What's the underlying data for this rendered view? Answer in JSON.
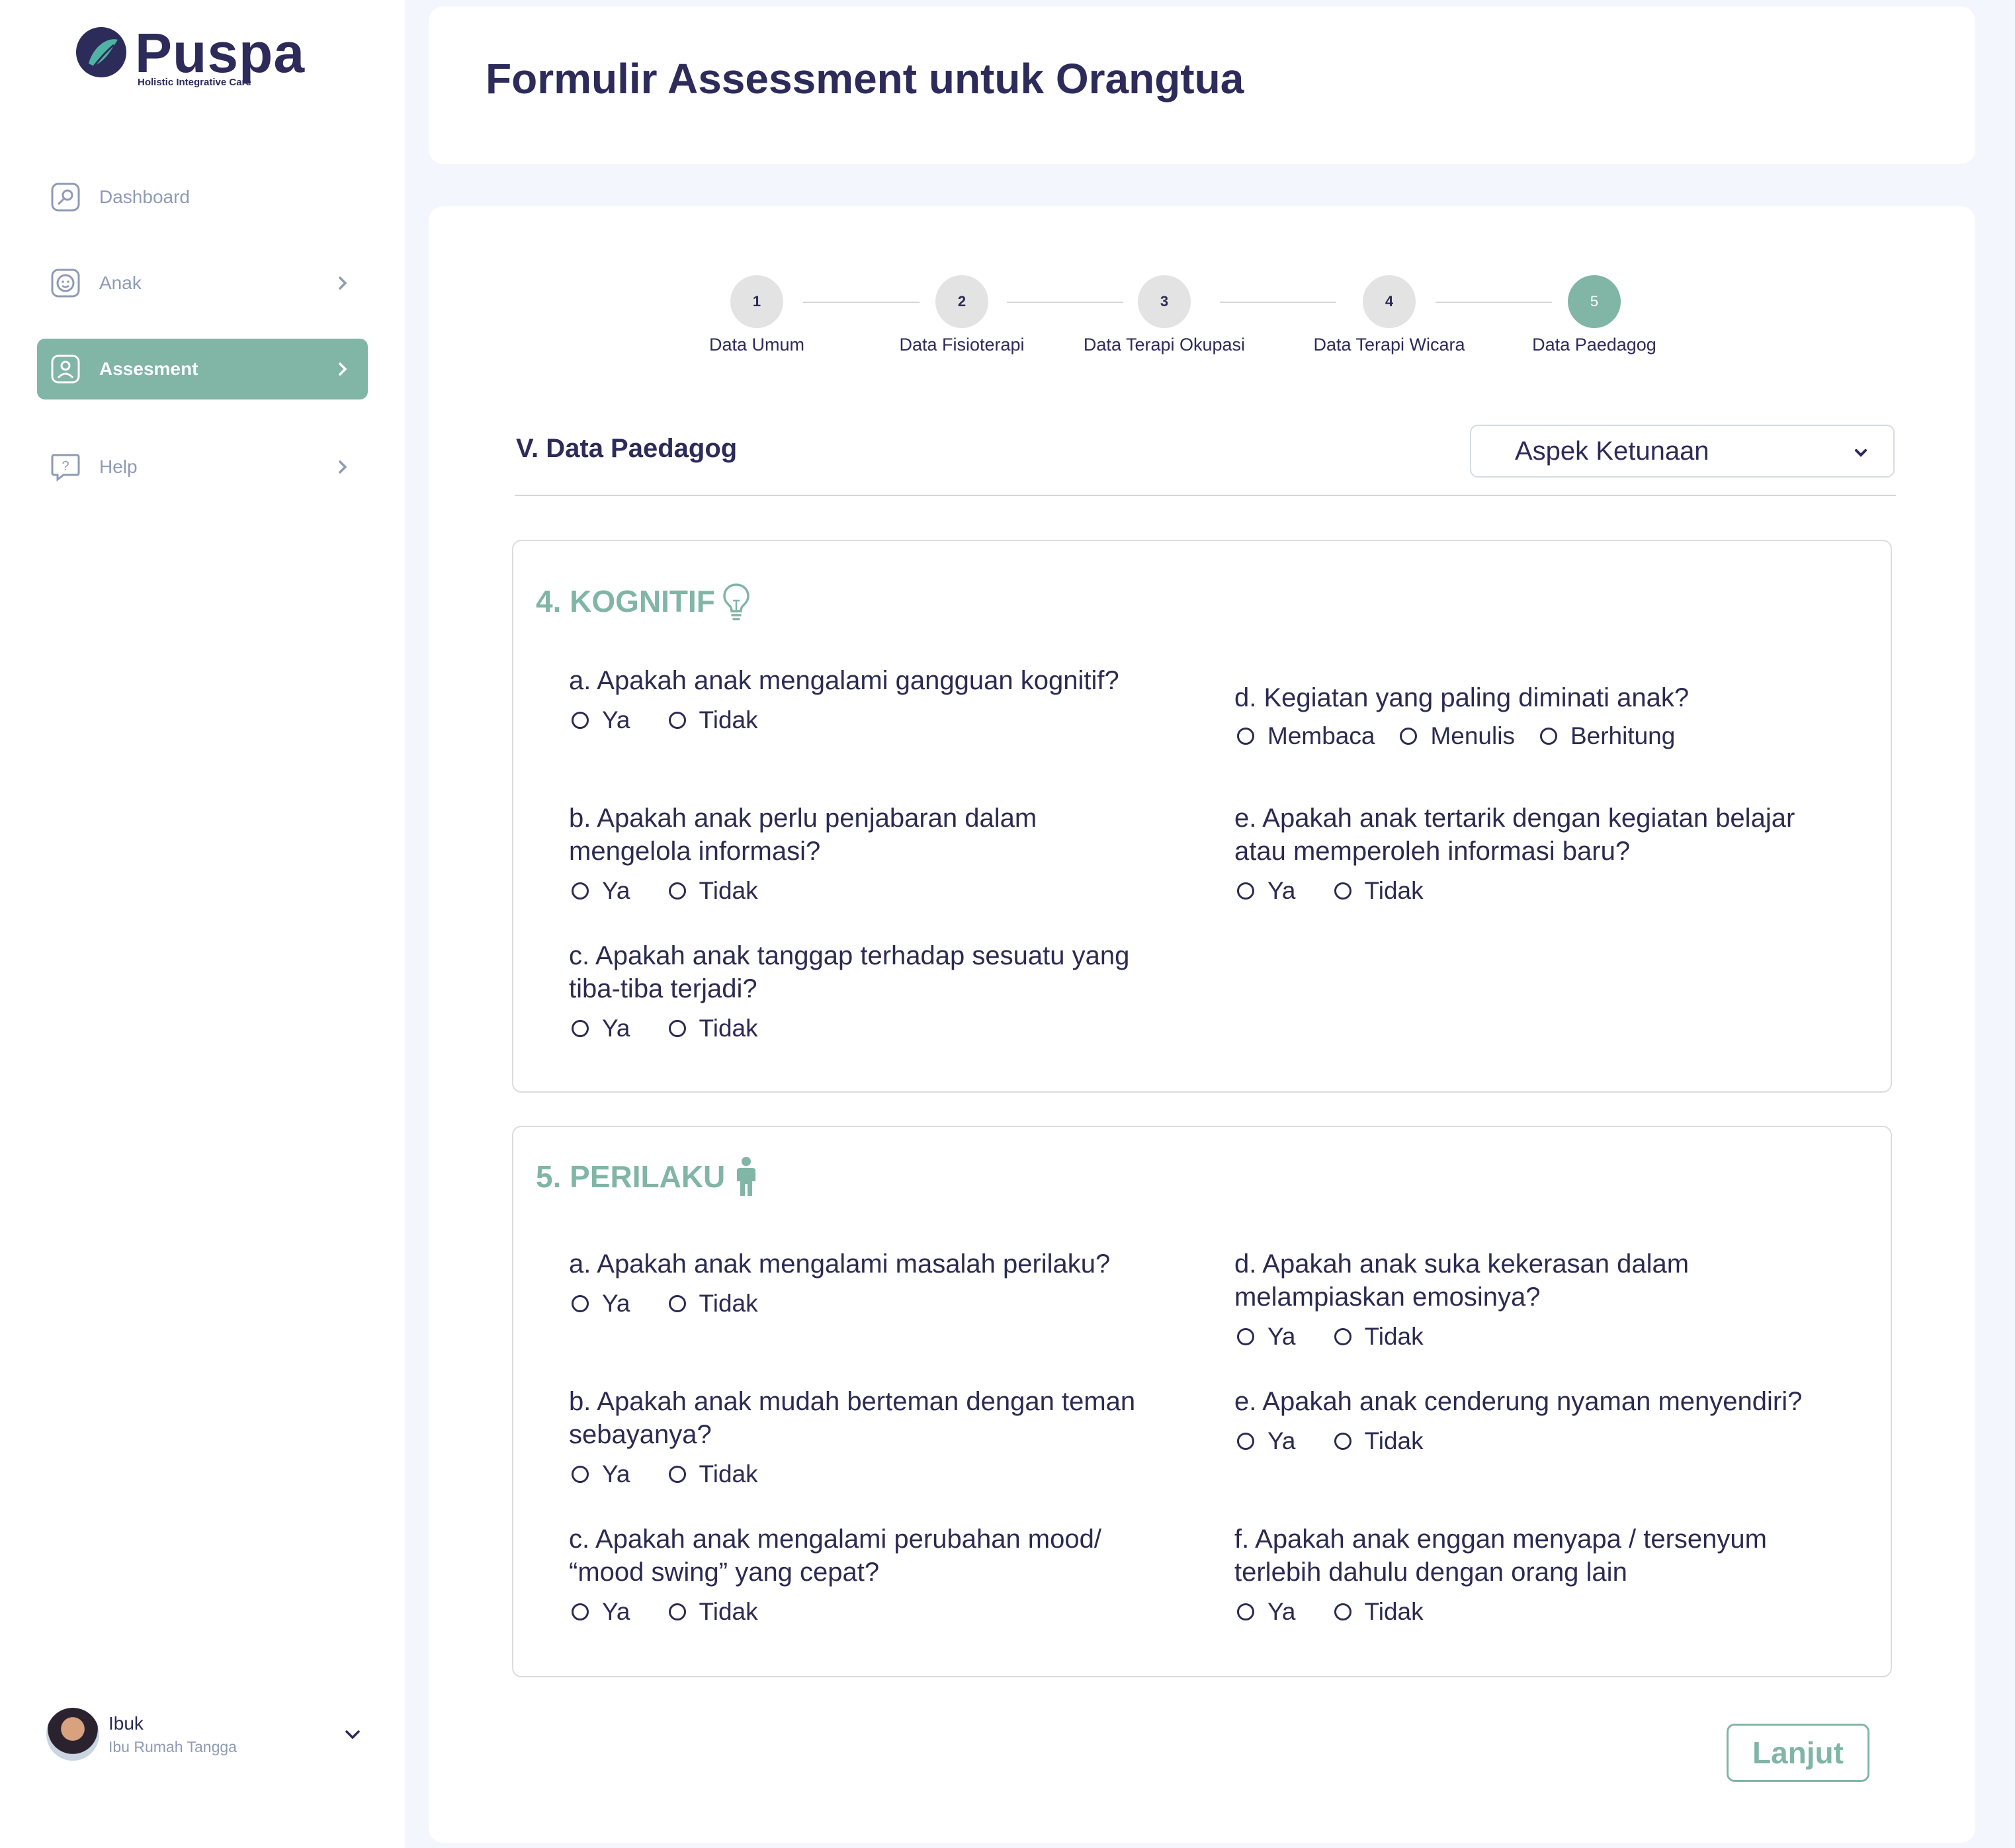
{
  "app": {
    "brand": "Puspa",
    "tagline": "Holistic Integrative Care"
  },
  "sidebar": {
    "items": [
      {
        "label": "Dashboard",
        "icon": "dashboard-icon"
      },
      {
        "label": "Anak",
        "icon": "child-face-icon"
      },
      {
        "label": "Assesment",
        "icon": "user-profile-icon",
        "active": true
      },
      {
        "label": "Help",
        "icon": "help-bubble-icon"
      }
    ],
    "user": {
      "name": "Ibuk",
      "role": "Ibu Rumah Tangga"
    }
  },
  "header": {
    "title": "Formulir Assessment untuk Orangtua"
  },
  "stepper": {
    "steps": [
      {
        "num": "1",
        "label": "Data Umum"
      },
      {
        "num": "2",
        "label": "Data Fisioterapi"
      },
      {
        "num": "3",
        "label": "Data Terapi Okupasi"
      },
      {
        "num": "4",
        "label": "Data Terapi Wicara"
      },
      {
        "num": "5",
        "label": "Data Paedagog"
      }
    ],
    "active_step": 5
  },
  "section": {
    "title": "V. Data Paedagog",
    "select_value": "Aspek Ketunaan"
  },
  "kognitif": {
    "title": "4. KOGNITIF",
    "questions": [
      {
        "text": "a. Apakah anak mengalami gangguan kognitif?",
        "options": [
          "Ya",
          "Tidak"
        ]
      },
      {
        "text": "b. Apakah anak perlu penjabaran dalam mengelola informasi?",
        "options": [
          "Ya",
          "Tidak"
        ]
      },
      {
        "text": "c. Apakah anak tanggap terhadap sesuatu yang tiba-tiba terjadi?",
        "options": [
          "Ya",
          "Tidak"
        ]
      },
      {
        "text": "d. Kegiatan yang paling diminati anak?",
        "options": [
          "Membaca",
          "Menulis",
          "Berhitung"
        ]
      },
      {
        "text": "e. Apakah anak tertarik dengan kegiatan belajar atau memperoleh informasi baru?",
        "options": [
          "Ya",
          "Tidak"
        ]
      }
    ]
  },
  "perilaku": {
    "title": "5. PERILAKU",
    "questions": [
      {
        "text": "a. Apakah anak mengalami masalah perilaku?",
        "options": [
          "Ya",
          "Tidak"
        ]
      },
      {
        "text": "b. Apakah anak mudah berteman dengan teman sebayanya?",
        "options": [
          "Ya",
          "Tidak"
        ]
      },
      {
        "text": "c. Apakah anak mengalami perubahan mood/ “mood swing” yang cepat?",
        "options": [
          "Ya",
          "Tidak"
        ]
      },
      {
        "text": "d. Apakah anak suka kekerasan dalam melampiaskan emosinya?",
        "options": [
          "Ya",
          "Tidak"
        ]
      },
      {
        "text": "e. Apakah anak cenderung nyaman menyendiri?",
        "options": [
          "Ya",
          "Tidak"
        ]
      },
      {
        "text": "f. Apakah anak enggan menyapa / tersenyum terlebih dahulu dengan orang lain",
        "options": [
          "Ya",
          "Tidak"
        ]
      }
    ]
  },
  "actions": {
    "next_label": "Lanjut"
  },
  "colors": {
    "accent": "#81b5a6",
    "navy": "#2d2b5a",
    "muted": "#8e9ab6"
  }
}
